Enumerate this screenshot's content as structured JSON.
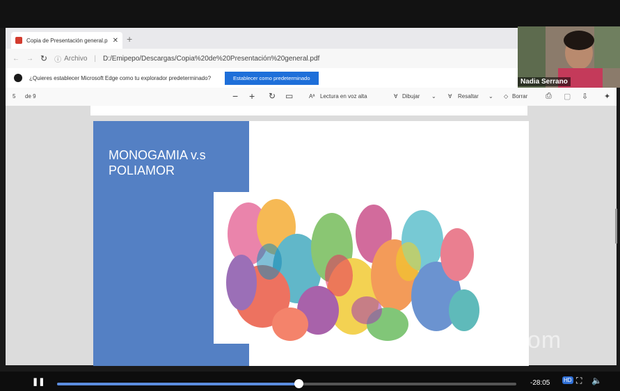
{
  "browser": {
    "tab_title": "Copia de Presentación general.p",
    "tab_close": "✕",
    "new_tab": "+",
    "address_label": "Archivo",
    "address_url": "D:/Emipepo/Descargas/Copia%20de%20Presentación%20general.pdf",
    "infobar_text": "¿Quieres establecer Microsoft Edge como tu explorador predeterminado?",
    "infobar_button": "Establecer como predeterminado"
  },
  "pdf_toolbar": {
    "page_number": "5",
    "page_total": "de 9",
    "read_aloud": "Lectura en voz alta",
    "draw": "Dibujar",
    "highlight": "Resaltar",
    "erase": "Borrar"
  },
  "slide": {
    "title_line1": "MONOGAMIA v.s",
    "title_line2": "POLIAMOR"
  },
  "video": {
    "participant_name": "Nadia Serrano"
  },
  "player": {
    "time_remaining": "-28:05",
    "hd_badge": "HD",
    "progress": 0.525
  },
  "watermark": "zoom",
  "colors": {
    "slide_blue": "#5480c4",
    "primary_button": "#1e6fd9",
    "progress_fill": "#5b8de0"
  }
}
